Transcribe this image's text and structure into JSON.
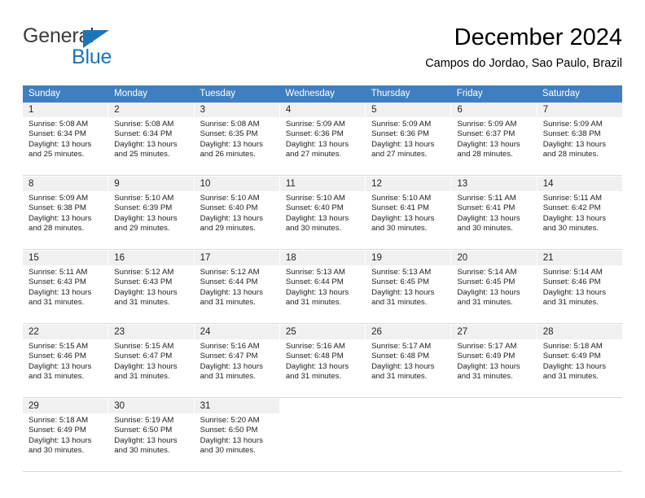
{
  "brand": {
    "name_top": "General",
    "name_bottom": "Blue",
    "triangle_icon": "triangle-icon",
    "color_dark": "#3c3c3c",
    "color_blue": "#1b75bb"
  },
  "header": {
    "title": "December 2024",
    "subtitle": "Campos do Jordao, Sao Paulo, Brazil"
  },
  "calendar": {
    "header_bg": "#3f7fc1",
    "daynum_bg": "#f0f0f0",
    "weekdays": [
      "Sunday",
      "Monday",
      "Tuesday",
      "Wednesday",
      "Thursday",
      "Friday",
      "Saturday"
    ],
    "weeks": [
      [
        {
          "day": "1",
          "sunrise": "Sunrise: 5:08 AM",
          "sunset": "Sunset: 6:34 PM",
          "daylight_1": "Daylight: 13 hours",
          "daylight_2": "and 25 minutes."
        },
        {
          "day": "2",
          "sunrise": "Sunrise: 5:08 AM",
          "sunset": "Sunset: 6:34 PM",
          "daylight_1": "Daylight: 13 hours",
          "daylight_2": "and 25 minutes."
        },
        {
          "day": "3",
          "sunrise": "Sunrise: 5:08 AM",
          "sunset": "Sunset: 6:35 PM",
          "daylight_1": "Daylight: 13 hours",
          "daylight_2": "and 26 minutes."
        },
        {
          "day": "4",
          "sunrise": "Sunrise: 5:09 AM",
          "sunset": "Sunset: 6:36 PM",
          "daylight_1": "Daylight: 13 hours",
          "daylight_2": "and 27 minutes."
        },
        {
          "day": "5",
          "sunrise": "Sunrise: 5:09 AM",
          "sunset": "Sunset: 6:36 PM",
          "daylight_1": "Daylight: 13 hours",
          "daylight_2": "and 27 minutes."
        },
        {
          "day": "6",
          "sunrise": "Sunrise: 5:09 AM",
          "sunset": "Sunset: 6:37 PM",
          "daylight_1": "Daylight: 13 hours",
          "daylight_2": "and 28 minutes."
        },
        {
          "day": "7",
          "sunrise": "Sunrise: 5:09 AM",
          "sunset": "Sunset: 6:38 PM",
          "daylight_1": "Daylight: 13 hours",
          "daylight_2": "and 28 minutes."
        }
      ],
      [
        {
          "day": "8",
          "sunrise": "Sunrise: 5:09 AM",
          "sunset": "Sunset: 6:38 PM",
          "daylight_1": "Daylight: 13 hours",
          "daylight_2": "and 28 minutes."
        },
        {
          "day": "9",
          "sunrise": "Sunrise: 5:10 AM",
          "sunset": "Sunset: 6:39 PM",
          "daylight_1": "Daylight: 13 hours",
          "daylight_2": "and 29 minutes."
        },
        {
          "day": "10",
          "sunrise": "Sunrise: 5:10 AM",
          "sunset": "Sunset: 6:40 PM",
          "daylight_1": "Daylight: 13 hours",
          "daylight_2": "and 29 minutes."
        },
        {
          "day": "11",
          "sunrise": "Sunrise: 5:10 AM",
          "sunset": "Sunset: 6:40 PM",
          "daylight_1": "Daylight: 13 hours",
          "daylight_2": "and 30 minutes."
        },
        {
          "day": "12",
          "sunrise": "Sunrise: 5:10 AM",
          "sunset": "Sunset: 6:41 PM",
          "daylight_1": "Daylight: 13 hours",
          "daylight_2": "and 30 minutes."
        },
        {
          "day": "13",
          "sunrise": "Sunrise: 5:11 AM",
          "sunset": "Sunset: 6:41 PM",
          "daylight_1": "Daylight: 13 hours",
          "daylight_2": "and 30 minutes."
        },
        {
          "day": "14",
          "sunrise": "Sunrise: 5:11 AM",
          "sunset": "Sunset: 6:42 PM",
          "daylight_1": "Daylight: 13 hours",
          "daylight_2": "and 30 minutes."
        }
      ],
      [
        {
          "day": "15",
          "sunrise": "Sunrise: 5:11 AM",
          "sunset": "Sunset: 6:43 PM",
          "daylight_1": "Daylight: 13 hours",
          "daylight_2": "and 31 minutes."
        },
        {
          "day": "16",
          "sunrise": "Sunrise: 5:12 AM",
          "sunset": "Sunset: 6:43 PM",
          "daylight_1": "Daylight: 13 hours",
          "daylight_2": "and 31 minutes."
        },
        {
          "day": "17",
          "sunrise": "Sunrise: 5:12 AM",
          "sunset": "Sunset: 6:44 PM",
          "daylight_1": "Daylight: 13 hours",
          "daylight_2": "and 31 minutes."
        },
        {
          "day": "18",
          "sunrise": "Sunrise: 5:13 AM",
          "sunset": "Sunset: 6:44 PM",
          "daylight_1": "Daylight: 13 hours",
          "daylight_2": "and 31 minutes."
        },
        {
          "day": "19",
          "sunrise": "Sunrise: 5:13 AM",
          "sunset": "Sunset: 6:45 PM",
          "daylight_1": "Daylight: 13 hours",
          "daylight_2": "and 31 minutes."
        },
        {
          "day": "20",
          "sunrise": "Sunrise: 5:14 AM",
          "sunset": "Sunset: 6:45 PM",
          "daylight_1": "Daylight: 13 hours",
          "daylight_2": "and 31 minutes."
        },
        {
          "day": "21",
          "sunrise": "Sunrise: 5:14 AM",
          "sunset": "Sunset: 6:46 PM",
          "daylight_1": "Daylight: 13 hours",
          "daylight_2": "and 31 minutes."
        }
      ],
      [
        {
          "day": "22",
          "sunrise": "Sunrise: 5:15 AM",
          "sunset": "Sunset: 6:46 PM",
          "daylight_1": "Daylight: 13 hours",
          "daylight_2": "and 31 minutes."
        },
        {
          "day": "23",
          "sunrise": "Sunrise: 5:15 AM",
          "sunset": "Sunset: 6:47 PM",
          "daylight_1": "Daylight: 13 hours",
          "daylight_2": "and 31 minutes."
        },
        {
          "day": "24",
          "sunrise": "Sunrise: 5:16 AM",
          "sunset": "Sunset: 6:47 PM",
          "daylight_1": "Daylight: 13 hours",
          "daylight_2": "and 31 minutes."
        },
        {
          "day": "25",
          "sunrise": "Sunrise: 5:16 AM",
          "sunset": "Sunset: 6:48 PM",
          "daylight_1": "Daylight: 13 hours",
          "daylight_2": "and 31 minutes."
        },
        {
          "day": "26",
          "sunrise": "Sunrise: 5:17 AM",
          "sunset": "Sunset: 6:48 PM",
          "daylight_1": "Daylight: 13 hours",
          "daylight_2": "and 31 minutes."
        },
        {
          "day": "27",
          "sunrise": "Sunrise: 5:17 AM",
          "sunset": "Sunset: 6:49 PM",
          "daylight_1": "Daylight: 13 hours",
          "daylight_2": "and 31 minutes."
        },
        {
          "day": "28",
          "sunrise": "Sunrise: 5:18 AM",
          "sunset": "Sunset: 6:49 PM",
          "daylight_1": "Daylight: 13 hours",
          "daylight_2": "and 31 minutes."
        }
      ],
      [
        {
          "day": "29",
          "sunrise": "Sunrise: 5:18 AM",
          "sunset": "Sunset: 6:49 PM",
          "daylight_1": "Daylight: 13 hours",
          "daylight_2": "and 30 minutes."
        },
        {
          "day": "30",
          "sunrise": "Sunrise: 5:19 AM",
          "sunset": "Sunset: 6:50 PM",
          "daylight_1": "Daylight: 13 hours",
          "daylight_2": "and 30 minutes."
        },
        {
          "day": "31",
          "sunrise": "Sunrise: 5:20 AM",
          "sunset": "Sunset: 6:50 PM",
          "daylight_1": "Daylight: 13 hours",
          "daylight_2": "and 30 minutes."
        },
        {
          "day": "",
          "sunrise": "",
          "sunset": "",
          "daylight_1": "",
          "daylight_2": ""
        },
        {
          "day": "",
          "sunrise": "",
          "sunset": "",
          "daylight_1": "",
          "daylight_2": ""
        },
        {
          "day": "",
          "sunrise": "",
          "sunset": "",
          "daylight_1": "",
          "daylight_2": ""
        },
        {
          "day": "",
          "sunrise": "",
          "sunset": "",
          "daylight_1": "",
          "daylight_2": ""
        }
      ]
    ]
  }
}
